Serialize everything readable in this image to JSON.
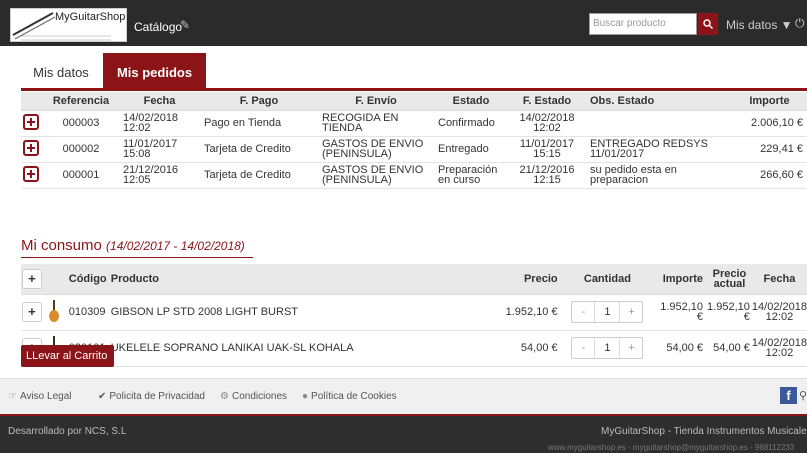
{
  "header": {
    "logo_text": "MyGuitarShop",
    "catalog": "Catálogo",
    "search_placeholder": "Buscar producto",
    "user_menu": "Mis datos ▼"
  },
  "tabs": [
    {
      "label": "Mis datos",
      "active": false
    },
    {
      "label": "Mis pedidos",
      "active": true
    }
  ],
  "orders": {
    "headers": [
      "Referencia",
      "Fecha",
      "F. Pago",
      "F. Envío",
      "Estado",
      "F. Estado",
      "Obs. Estado",
      "Importe"
    ],
    "rows": [
      {
        "ref": "000003",
        "date": "14/02/2018",
        "time": "12:02",
        "pago": "Pago en Tienda",
        "envio1": "RECOGIDA EN",
        "envio2": "TIENDA",
        "estado1": "Confirmado",
        "estado2": "",
        "fdate": "14/02/2018",
        "ftime": "12:02",
        "obs1": "",
        "obs2": "",
        "importe": "2.006,10 €"
      },
      {
        "ref": "000002",
        "date": "11/01/2017",
        "time": "15:08",
        "pago": "Tarjeta de Credito",
        "envio1": "GASTOS DE ENVIO",
        "envio2": "(PENINSULA)",
        "estado1": "Entregado",
        "estado2": "",
        "fdate": "11/01/2017",
        "ftime": "15:15",
        "obs1": "ENTREGADO REDSYS",
        "obs2": "11/01/2017",
        "importe": "229,41 €"
      },
      {
        "ref": "000001",
        "date": "21/12/2016",
        "time": "12:05",
        "pago": "Tarjeta de Credito",
        "envio1": "GASTOS DE ENVIO",
        "envio2": "(PENINSULA)",
        "estado1": "Preparación",
        "estado2": "en curso",
        "fdate": "21/12/2016",
        "ftime": "12:15",
        "obs1": "su pedido esta en",
        "obs2": "preparacion",
        "importe": "266,60 €"
      }
    ]
  },
  "consumo": {
    "title": "Mi consumo",
    "range": "(14/02/2017 - 14/02/2018)",
    "headers": {
      "codigo": "Código",
      "producto": "Producto",
      "precio": "Precio",
      "cantidad": "Cantidad",
      "importe": "Importe",
      "precio_actual_1": "Precio",
      "precio_actual_2": "actual",
      "fecha": "Fecha"
    },
    "rows": [
      {
        "codigo": "010309",
        "producto": "GIBSON LP STD 2008 LIGHT BURST",
        "precio": "1.952,10 €",
        "qty": "1",
        "importe": "1.952,10 €",
        "actual": "1.952,10 €",
        "date": "14/02/2018",
        "time": "12:02"
      },
      {
        "codigo": "030101",
        "producto": "UKELELE SOPRANO LANIKAI UAK-SL KOHALA",
        "precio": "54,00 €",
        "qty": "1",
        "importe": "54,00 €",
        "actual": "54,00 €",
        "date": "14/02/2018",
        "time": "12:02"
      }
    ],
    "cart_button": "LLevar al Carrito"
  },
  "footer": {
    "links": [
      "Aviso Legal",
      "Policita de Privacidad",
      "Condiciones",
      "Política de Cookies"
    ],
    "dev": "Desarrollado por NCS, S.L",
    "shop": "MyGuitarShop - Tienda Instrumentos Musicales",
    "contact": "www.myguitarshop.es - myguitarshop@myguitarshop.es - 968112233"
  },
  "colors": {
    "brand": "#8b1418",
    "topbar": "#2b2b2b"
  }
}
